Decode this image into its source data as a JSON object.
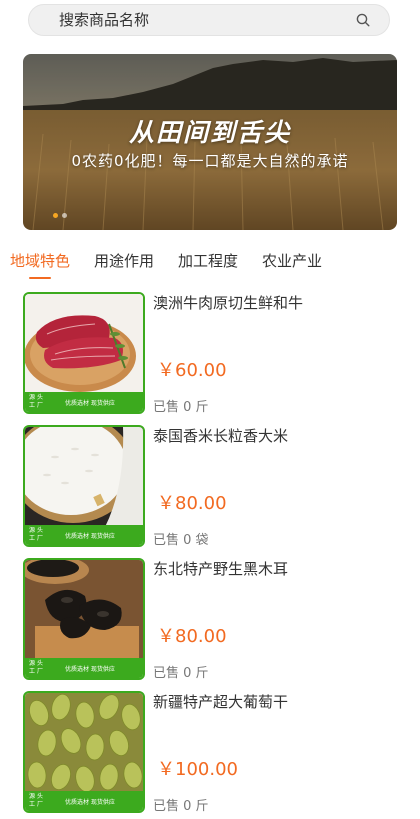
{
  "search": {
    "placeholder": "搜索商品名称",
    "icon": "search-icon"
  },
  "banner": {
    "title": "从田间到舌尖",
    "subtitle": "0农药0化肥！每一口都是大自然的承诺",
    "dot_count": 2,
    "active_dot": 0
  },
  "tabs": [
    {
      "label": "地域特色",
      "active": true
    },
    {
      "label": "用途作用",
      "active": false
    },
    {
      "label": "加工程度",
      "active": false
    },
    {
      "label": "农业产业",
      "active": false
    }
  ],
  "thumb_badge": {
    "brand_top": "源 头",
    "brand_bottom": "工 厂",
    "tagline": "优质选材 现货供应"
  },
  "products": [
    {
      "name": "澳洲牛肉原切生鲜和牛",
      "price": "￥60.00",
      "sold": "已售 0 斤",
      "image": "beef-steak"
    },
    {
      "name": "泰国香米长粒香大米",
      "price": "￥80.00",
      "sold": "已售 0 袋",
      "image": "rice"
    },
    {
      "name": "东北特产野生黑木耳",
      "price": "￥80.00",
      "sold": "已售 0 斤",
      "image": "black-fungus"
    },
    {
      "name": "新疆特产超大葡萄干",
      "price": "￥100.00",
      "sold": "已售 0 斤",
      "image": "raisins"
    }
  ],
  "colors": {
    "accent": "#f26a21",
    "badge_green": "#3caa1e"
  }
}
